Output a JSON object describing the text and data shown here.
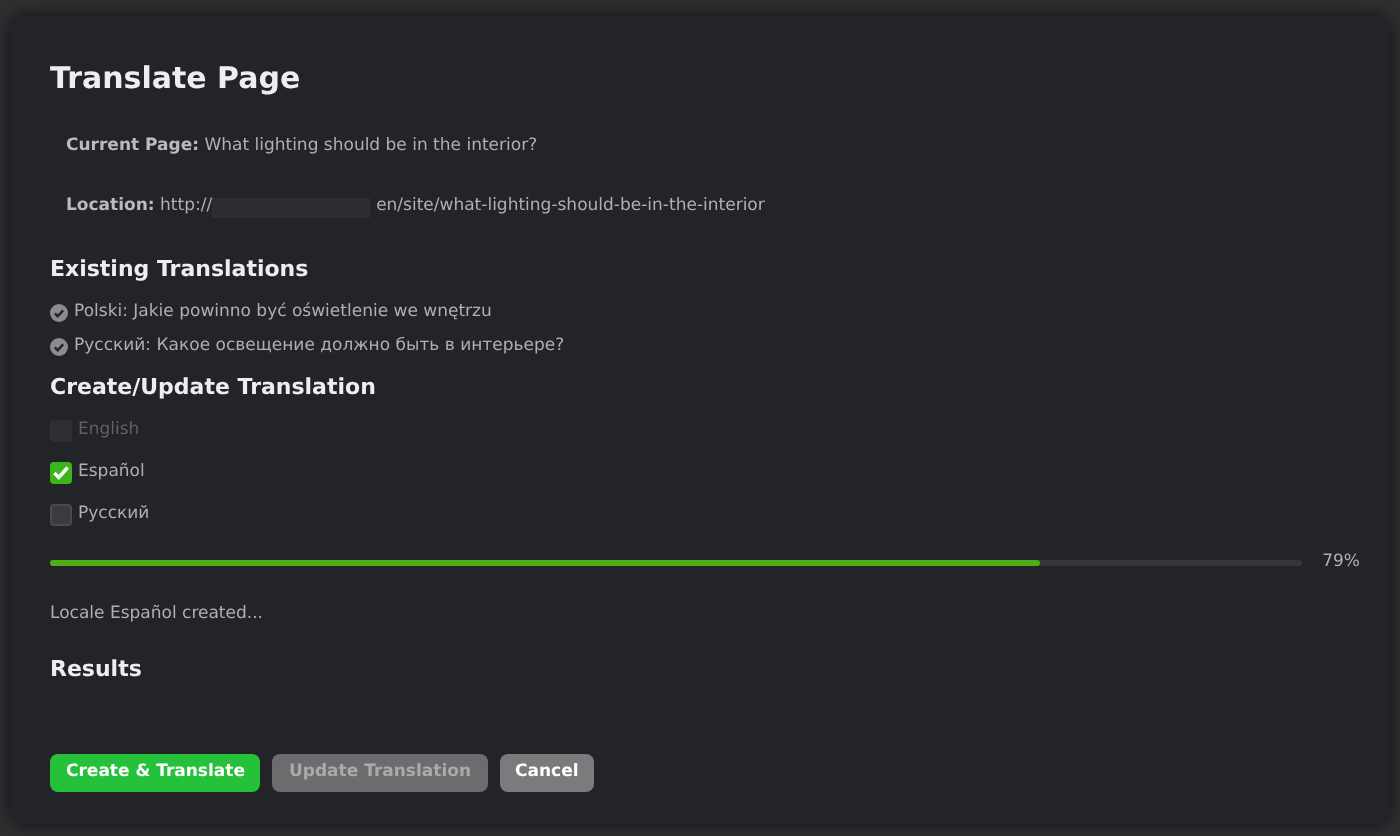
{
  "dialog": {
    "title": "Translate Page",
    "current_page": {
      "label": "Current Page:",
      "value": "What lighting should be in the interior?"
    },
    "location": {
      "label": "Location:",
      "url_start": "http://",
      "url_end": "en/site/what-lighting-should-be-in-the-interior"
    },
    "existing_translations": {
      "heading": "Existing Translations",
      "items": [
        {
          "text": "Polski: Jakie powinno być oświetlenie we wnętrzu"
        },
        {
          "text": "Русский: Какое освещение должно быть в интерьере?"
        }
      ]
    },
    "create_update": {
      "heading": "Create/Update Translation",
      "languages": [
        {
          "label": "English",
          "checked": false,
          "disabled": true
        },
        {
          "label": "Español",
          "checked": true,
          "disabled": false
        },
        {
          "label": "Русский",
          "checked": false,
          "disabled": false
        }
      ]
    },
    "progress": {
      "level": 0.79,
      "reading": "79%"
    },
    "status": "Locale Español created...",
    "results": {
      "heading": "Results"
    },
    "buttons": [
      {
        "label": "Create & Translate",
        "kind": "primary",
        "disabled": false
      },
      {
        "label": "Update Translation",
        "kind": "secondary",
        "disabled": true
      },
      {
        "label": "Cancel",
        "kind": "secondary",
        "disabled": false
      }
    ]
  }
}
